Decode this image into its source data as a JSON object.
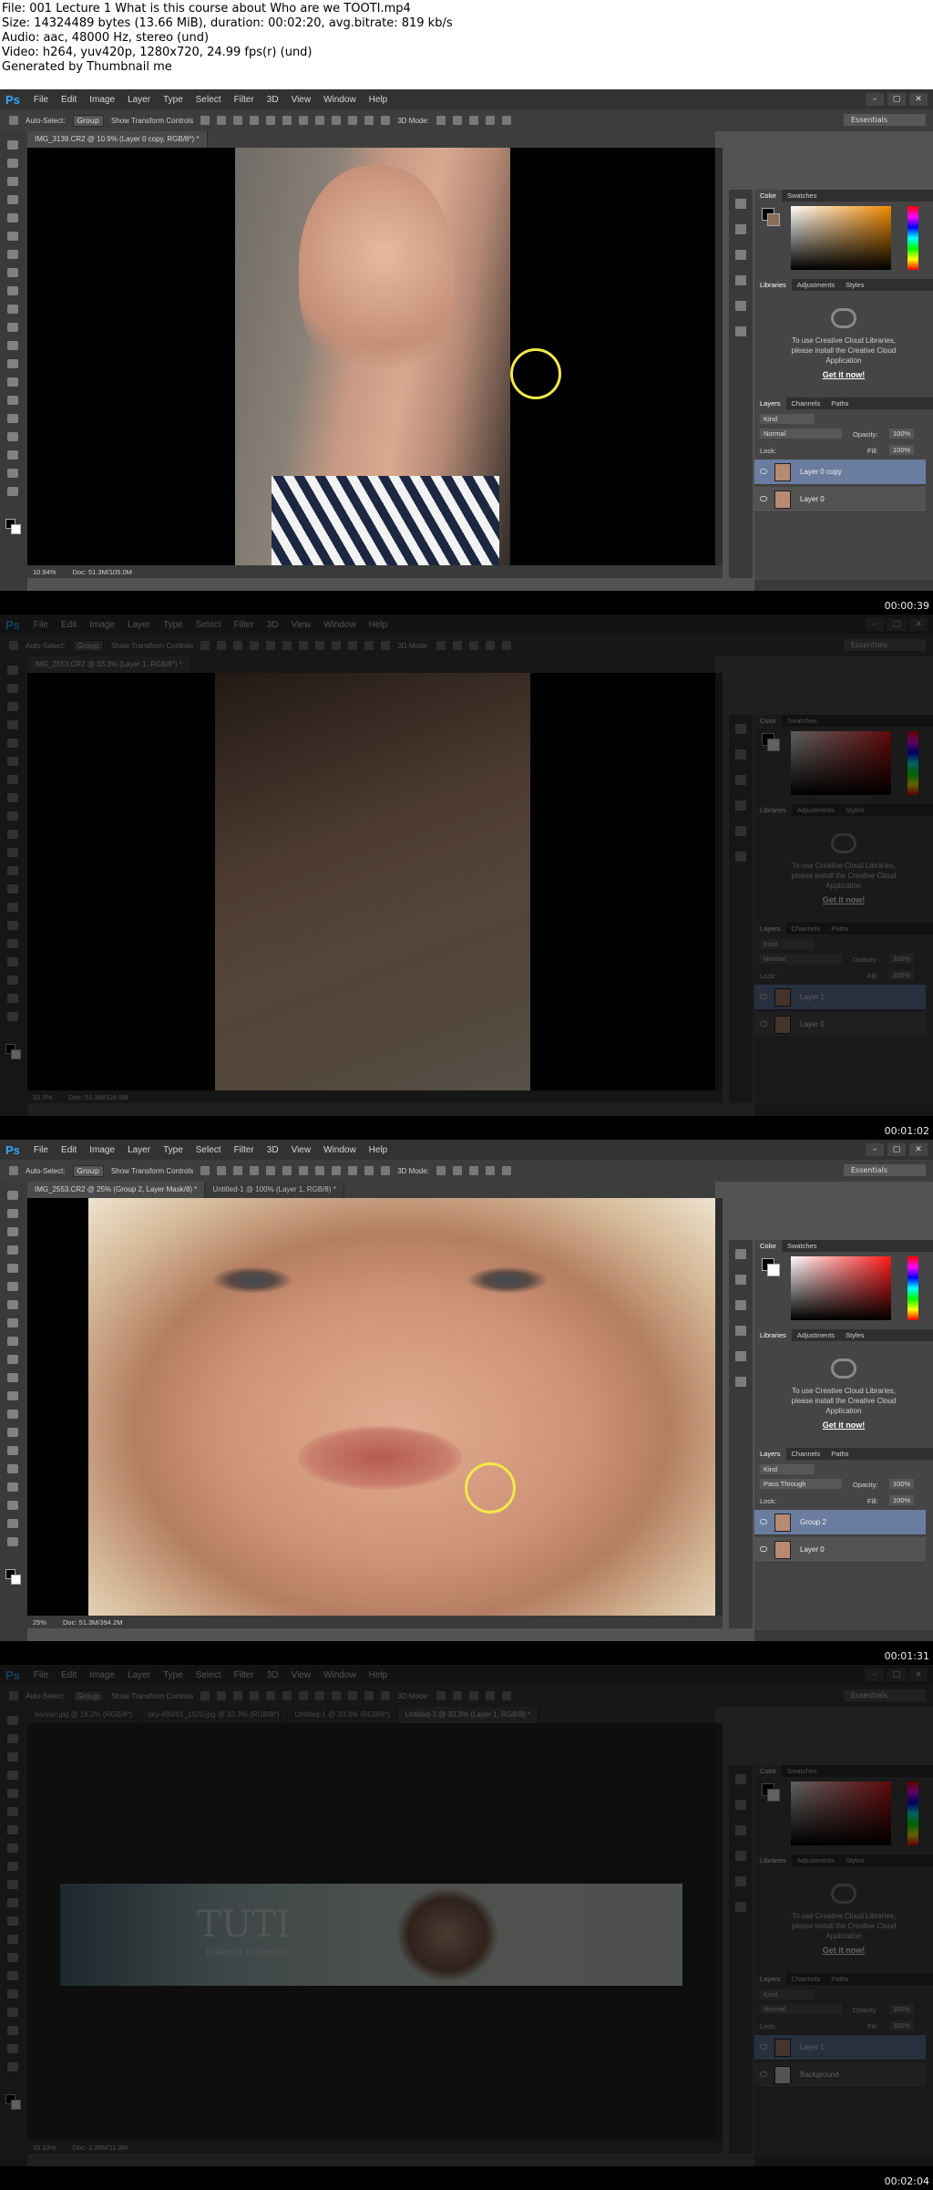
{
  "header": {
    "line1": "File: 001 Lecture 1 What is this course about Who are we TOOTI.mp4",
    "line2": "Size: 14324489 bytes (13.66 MiB), duration: 00:02:20, avg.bitrate: 819 kb/s",
    "line3": "Audio: aac, 48000 Hz, stereo (und)",
    "line4": "Video: h264, yuv420p, 1280x720, 24.99 fps(r) (und)",
    "line5": "Generated by Thumbnail me"
  },
  "app": {
    "logo": "Ps",
    "menu": [
      "File",
      "Edit",
      "Image",
      "Layer",
      "Type",
      "Select",
      "Filter",
      "3D",
      "View",
      "Window",
      "Help"
    ],
    "window_buttons": [
      "–",
      "▢",
      "✕"
    ],
    "options": {
      "auto_select": "Auto-Select:",
      "group": "Group",
      "show_transform": "Show Transform Controls",
      "mode_3d": "3D Mode:",
      "workspace": "Essentials"
    },
    "panel_tabs": {
      "color": [
        "Color",
        "Swatches"
      ],
      "libraries": [
        "Libraries",
        "Adjustments",
        "Styles"
      ],
      "layers": [
        "Layers",
        "Channels",
        "Paths"
      ]
    },
    "libraries_message": [
      "To use Creative Cloud Libraries,",
      "please install the Creative Cloud",
      "Application"
    ],
    "get_it_now": "Get it now!",
    "layers_labels": {
      "kind": "Kind",
      "opacity": "Opacity:",
      "fill": "Fill:",
      "lock": "Lock:",
      "hundred": "100%"
    }
  },
  "frames": [
    {
      "timestamp": "00:00:39",
      "tabs": [
        "IMG_3139.CR2 @ 10.9% (Layer 0 copy, RGB/8*) *"
      ],
      "zoom": "10.94%",
      "doc": "Doc: 51.3M/105.0M",
      "blend": "Normal",
      "layers": [
        {
          "name": "Layer 0 copy",
          "selected": true
        },
        {
          "name": "Layer 0",
          "selected": false
        }
      ]
    },
    {
      "timestamp": "00:01:02",
      "tabs": [
        "IMG_2553.CR2 @ 33.3% (Layer 1, RGB/8*) *"
      ],
      "zoom": "33.3%",
      "doc": "Doc: 51.3M/128.6M",
      "blend": "Normal",
      "layers": [
        {
          "name": "Layer 1",
          "selected": true
        },
        {
          "name": "Layer 0",
          "selected": false
        }
      ]
    },
    {
      "timestamp": "00:01:31",
      "tabs": [
        "IMG_2553.CR2 @ 25% (Group 2, Layer Mask/8) *",
        "Untitled-1 @ 100% (Layer 1, RGB/8) *"
      ],
      "zoom": "25%",
      "doc": "Doc: 51.3M/394.2M",
      "blend": "Pass Through",
      "layers": [
        {
          "name": "Group 2",
          "selected": true
        },
        {
          "name": "Layer 0",
          "selected": false
        }
      ]
    },
    {
      "timestamp": "00:02:04",
      "tabs": [
        "banner.jpg @ 16.2% (RGB/8*)",
        "sky-490/91_1920.jpg @ 33.3% (RGB/8*)",
        "Untitled-1 @ 33.3% (RGB/8*)",
        "Untitled-3 @ 33.3% (Layer 1, RGB/8) *"
      ],
      "zoom": "33.33%",
      "doc": "Doc: 3.38M/11.8M",
      "blend": "Normal",
      "banner_title": "TUTI",
      "banner_subtitle": "makeup & beauty",
      "layers": [
        {
          "name": "Layer 1",
          "selected": true
        },
        {
          "name": "Background",
          "selected": false
        }
      ]
    }
  ]
}
